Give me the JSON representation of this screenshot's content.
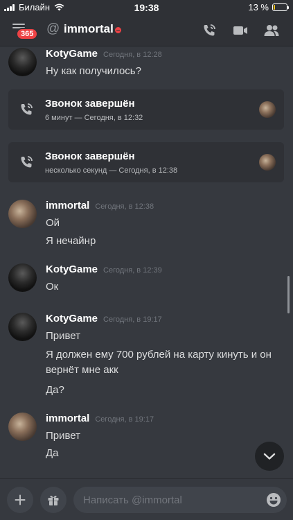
{
  "status_bar": {
    "carrier": "Билайн",
    "time": "19:38",
    "battery": "13 %"
  },
  "header": {
    "unread_badge": "365",
    "at_symbol": "@",
    "title": "immortal"
  },
  "messages": [
    {
      "author": "KotyGame",
      "time": "Сегодня, в 12:28",
      "lines": [
        "Ну как получилось?"
      ]
    },
    {
      "author": "immortal",
      "time": "Сегодня, в 12:38",
      "lines": [
        "Ой",
        "Я нечайнр"
      ]
    },
    {
      "author": "KotyGame",
      "time": "Сегодня, в 12:39",
      "lines": [
        "Ок"
      ]
    },
    {
      "author": "KotyGame",
      "time": "Сегодня, в 19:17",
      "lines": [
        "Привет",
        "Я должен ему 700 рублей на карту кинуть и он вернёт мне акк",
        "Да?"
      ]
    },
    {
      "author": "immortal",
      "time": "Сегодня, в 19:17",
      "lines": [
        "Привет",
        "Да"
      ]
    }
  ],
  "calls": [
    {
      "title": "Звонок завершён",
      "subtitle": "6 минут — Сегодня, в 12:32"
    },
    {
      "title": "Звонок завершён",
      "subtitle": "несколько секунд — Сегодня, в 12:38"
    }
  ],
  "composer": {
    "placeholder": "Написать @immortal"
  },
  "colors": {
    "background": "#36393f",
    "header": "#2f3136",
    "badge": "#ed4245",
    "battery": "#f0c419"
  }
}
